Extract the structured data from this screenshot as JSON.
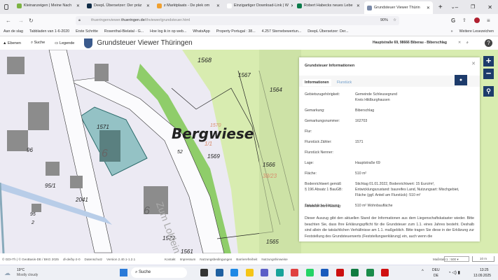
{
  "browser": {
    "tabs": [
      {
        "label": "Kleinanzeigen | Meine Nach",
        "color": "#7cb342"
      },
      {
        "label": "DeepL Übersetzer: Der präz",
        "color": "#0f2b46"
      },
      {
        "label": "z Marktplaats - De plek om",
        "color": "#f0a030"
      },
      {
        "label": "Einzigartiger Download-Link | W",
        "color": "#ffffff"
      },
      {
        "label": "Robert Habecks neues Lebe",
        "color": "#0a7a4a"
      },
      {
        "label": "Grundsteuer Viewer Thürin",
        "color": "#7a8aa8"
      }
    ],
    "url_prefix": "thueringenviewer.",
    "url_domain": "thueringen.de",
    "url_path": "/thviewer/grundsteuer.html",
    "zoom": "90%",
    "bookmarks": [
      "Aan de slag",
      "Tabbladen van 1-6-2020",
      "Erste Schritte",
      "Rosenthal-Bielatal - G...",
      "Hoe log ik in op web...",
      "WhatsApp",
      "Property Portugal : 38...",
      "4.257 Sternebewertun...",
      "DeepL Übersetzer: Der..."
    ],
    "other_bookmarks": "Weitere Lesezeichen"
  },
  "app": {
    "ebenen": "Ebenen",
    "suche": "Suche",
    "legende": "Legende",
    "title": "Grundsteuer Viewer Thüringen",
    "search_value": "Hauptstraße 69, 98666 Biberau - Biberschlag"
  },
  "map": {
    "labels": [
      "1568",
      "1567",
      "1564",
      "1571",
      "Bergwiese",
      "1569",
      "1566",
      "96",
      "95/1",
      "2041",
      "95",
      "2",
      "1572",
      "1565",
      "1561",
      "1/1",
      "52",
      "38/23",
      "6",
      "6",
      "1570"
    ],
    "street": "Zum Lohlein"
  },
  "panel": {
    "title": "Grundsteuer Informationen",
    "tabs": [
      "Informationen",
      "Flurstück"
    ],
    "rows": [
      {
        "k": "Gebietszugehörigkeit:",
        "v": "Gemeinde Schleusegrund\nKreis Hildburghausen"
      },
      {
        "k": "Gemarkung:",
        "v": "Biberschlag"
      },
      {
        "k": "Gemarkungsnummer:",
        "v": "162703"
      },
      {
        "k": "Flur:",
        "v": ""
      },
      {
        "k": "Flurstück Zähler:",
        "v": "1571"
      },
      {
        "k": "Flurstück Nenner:",
        "v": ""
      },
      {
        "k": "Lage:",
        "v": "Hauptstraße 69"
      },
      {
        "k": "Fläche:",
        "v": "510 m²"
      },
      {
        "k": "Bodenrichtwert gemäß\n§ 196 Absatz 1 BauGB:",
        "v": "Stichtag 01.01.2022, Bodenrichtwert: 15 Euro/m²,\nEntwicklungszustand: baureifes Land, Nutzungsart: Mischgebiet,\nFläche (ggf. Anteil am Flurstück): 510 m²"
      },
      {
        "k": "Tatsächliche Nutzung:",
        "v": "510 m² Wohnbaufläche"
      }
    ],
    "hint_title": "Hinweise zum Auszug:",
    "hint_text": "Dieser Auszug gibt den aktuellen Stand der Informationen aus dem Liegenschaftskataster wieder. Bitte beachten Sie, dass Ihre Erklärungspflicht für die Grundsteuer zum 1.1. eines Jahres besteht. Deshalb sind allein die tatsächlichen Verhältnisse am 1.1. maßgeblich. Bitte tragen Sie diese in der Erklärung zur Feststellung des Grundsteuerwerts (Feststellungserklärung) ein, auch wenn die"
  },
  "footer": {
    "left": "© GDI-Th | © GeoBasis-DE / BKG 2025",
    "items": [
      "dl-de/by-2-0",
      "Datenschutz",
      "Version 2.40.1-1.2.1"
    ],
    "links": [
      "Kontakt",
      "Impressum",
      "Nutzungsbedingungen",
      "Barrierefreiheit",
      "Nutzungshinweise"
    ],
    "scale_label": "Maßstab:",
    "scale": "1 : 500",
    "scalebar": "10 m"
  },
  "taskbar": {
    "weather_temp": "19°C",
    "weather_text": "Mostly cloudy",
    "search": "Suche",
    "lang1": "DEU",
    "lang2": "DE",
    "time": "13:25",
    "date": "13.09.2025"
  }
}
